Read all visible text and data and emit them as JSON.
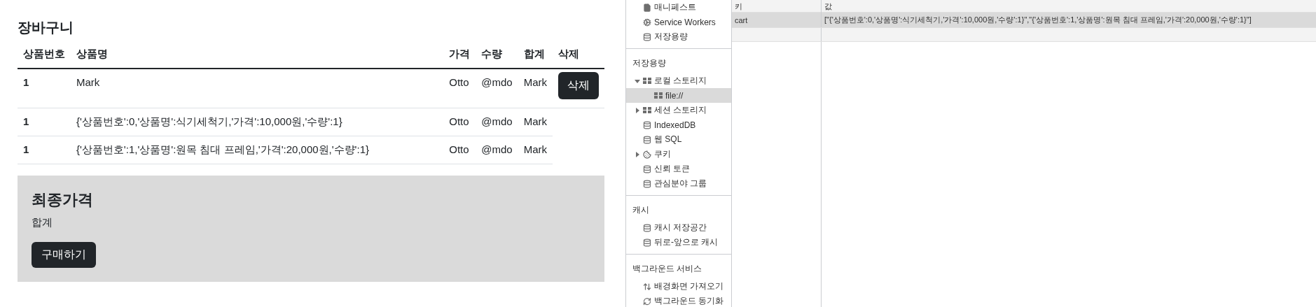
{
  "cart": {
    "title": "장바구니",
    "columns": [
      "상품번호",
      "상품명",
      "가격",
      "수량",
      "합계",
      "삭제"
    ],
    "rows": [
      {
        "number": "1",
        "name": "Mark",
        "price": "Otto",
        "quantity": "@mdo",
        "total": "Mark",
        "delete_button": "삭제"
      },
      {
        "number": "1",
        "name": "{'상품번호':0,'상품명':식기세척기,'가격':10,000원,'수량':1}",
        "price": "Otto",
        "quantity": "@mdo",
        "total": "Mark"
      },
      {
        "number": "1",
        "name": "{'상품번호':1,'상품명':원목 침대 프레임,'가격':20,000원,'수량':1}",
        "price": "Otto",
        "quantity": "@mdo",
        "total": "Mark"
      }
    ]
  },
  "summary": {
    "title": "최종가격",
    "label": "합계",
    "button": "구매하기"
  },
  "devtools": {
    "sidebar": [
      {
        "items": [
          {
            "label": "매니페스트",
            "kind": "file",
            "selected": false
          },
          {
            "label": "Service Workers",
            "kind": "gear",
            "selected": false
          },
          {
            "label": "저장용량",
            "kind": "database",
            "selected": false
          }
        ]
      },
      {
        "heading": "저장용량",
        "items": [
          {
            "label": "로컬 스토리지",
            "kind": "grid",
            "selected": false,
            "expanded": true,
            "children": [
              {
                "label": "file://",
                "kind": "grid",
                "selected": true
              }
            ]
          },
          {
            "label": "세션 스토리지",
            "kind": "grid",
            "selected": false,
            "expanded": false
          },
          {
            "label": "IndexedDB",
            "kind": "database",
            "selected": false
          },
          {
            "label": "웹 SQL",
            "kind": "database",
            "selected": false
          },
          {
            "label": "쿠키",
            "kind": "cookie",
            "selected": false,
            "expanded": false
          },
          {
            "label": "신뢰 토큰",
            "kind": "database",
            "selected": false
          },
          {
            "label": "관심분야 그룹",
            "kind": "database",
            "selected": false
          }
        ]
      },
      {
        "heading": "캐시",
        "items": [
          {
            "label": "캐시 저장공간",
            "kind": "database",
            "selected": false
          },
          {
            "label": "뒤로-앞으로 캐시",
            "kind": "database",
            "selected": false
          }
        ]
      },
      {
        "heading": "백그라운드 서비스",
        "items": [
          {
            "label": "배경화면 가져오기",
            "kind": "updown",
            "selected": false
          },
          {
            "label": "백그라운드 동기화",
            "kind": "sync",
            "selected": false
          }
        ]
      }
    ],
    "storage_table": {
      "columns": [
        "키",
        "값"
      ],
      "rows": [
        {
          "key": "cart",
          "value": "[\"{'상품번호':0,'상품명':식기세척기,'가격':10,000원,'수량':1}\",\"{'상품번호':1,'상품명':원목 침대 프레임,'가격':20,000원,'수량':1}\"]",
          "selected": true
        }
      ]
    }
  }
}
